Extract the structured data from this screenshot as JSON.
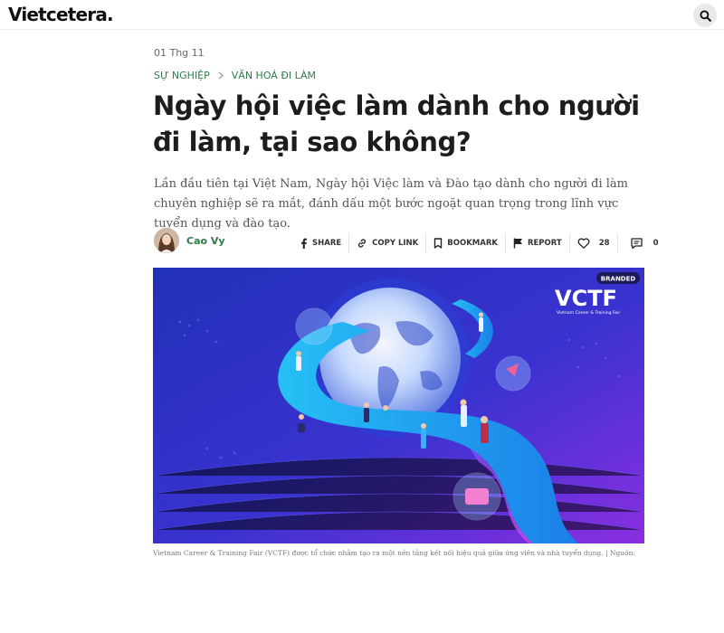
{
  "site": {
    "logo": "Vietcetera."
  },
  "article": {
    "date": "01 Thg 11",
    "breadcrumb": [
      "SỰ NGHIỆP",
      "VĂN HOÁ ĐI LÀM"
    ],
    "title": "Ngày hội việc làm dành cho người đi làm, tại sao không?",
    "lead": "Lần đầu tiên tại Việt Nam, Ngày hội Việc làm và Đào tạo dành cho người đi làm chuyên nghiệp sẽ ra mắt, đánh dấu một bước ngoặt quan trọng trong lĩnh vực tuyển dụng và đào tạo.",
    "author": "Cao Vy",
    "caption": "Vietnam Career & Training Fair (VCTF) được tổ chức nhằm tạo ra một nền tảng kết nối hiệu quả giữa ứng viên và nhà tuyển dụng. | Nguồn:"
  },
  "actions": {
    "share": "SHARE",
    "copy_link": "COPY LINK",
    "bookmark": "BOOKMARK",
    "report": "REPORT",
    "likes": "28",
    "comments": "0"
  },
  "hero": {
    "badge": "BRANDED",
    "brand": "VCTF",
    "brand_subtitle": "Vietnam Career & Training Fair"
  },
  "colors": {
    "accent_green": "#2f7a4b",
    "hero_bg_start": "#1b2db5",
    "hero_bg_end": "#8a2fe0",
    "ribbon": "#1ea9ee"
  }
}
